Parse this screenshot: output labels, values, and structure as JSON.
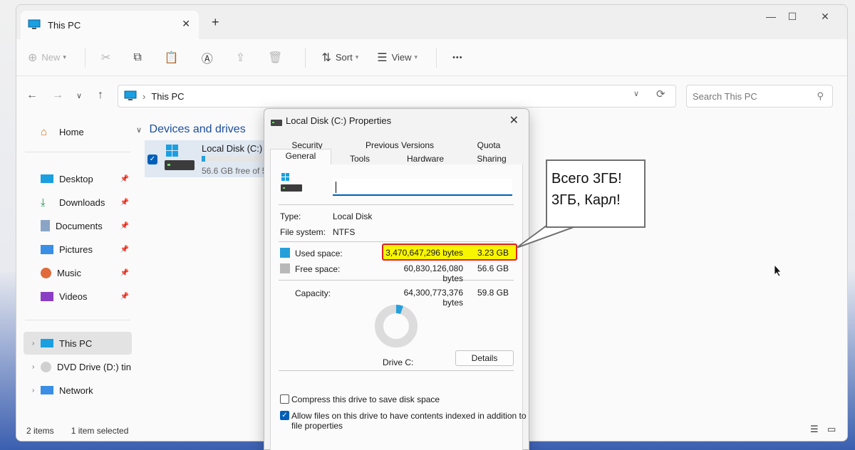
{
  "window": {
    "tab_title": "This PC",
    "new_tab_glyph": "+",
    "close_tab_glyph": "✕"
  },
  "toolbar": {
    "new_label": "New",
    "sort_label": "Sort",
    "view_label": "View",
    "more_glyph": "•••"
  },
  "address": {
    "crumb": "This PC",
    "search_placeholder": "Search This PC"
  },
  "sidebar": {
    "home": "Home",
    "pinned": [
      "Desktop",
      "Downloads",
      "Documents",
      "Pictures",
      "Music",
      "Videos"
    ],
    "this_pc": "This PC",
    "dvd": "DVD Drive (D:) tiny",
    "network": "Network"
  },
  "main": {
    "section_title": "Devices and drives",
    "drive_name": "Local Disk (C:)",
    "drive_free": "56.6 GB free of 5",
    "drive_used_fraction": 0.054
  },
  "status": {
    "items": "2 items",
    "selected": "1 item selected"
  },
  "dialog": {
    "title": "Local Disk (C:) Properties",
    "tabs_row1": [
      "Security",
      "Previous Versions",
      "Quota"
    ],
    "tabs_row2": [
      "General",
      "Tools",
      "Hardware",
      "Sharing"
    ],
    "type_label": "Type:",
    "type_value": "Local Disk",
    "fs_label": "File system:",
    "fs_value": "NTFS",
    "used_label": "Used space:",
    "used_bytes": "3,470,647,296 bytes",
    "used_gb": "3.23 GB",
    "free_label": "Free space:",
    "free_bytes": "60,830,126,080 bytes",
    "free_gb": "56.6 GB",
    "cap_label": "Capacity:",
    "cap_bytes": "64,300,773,376 bytes",
    "cap_gb": "59.8 GB",
    "drive_label": "Drive C:",
    "details_button": "Details",
    "compress_label": "Compress this drive to save disk space",
    "index_label_1": "Allow files on this drive to have contents indexed in addition to",
    "index_label_2": "file properties",
    "used_fraction": 0.054,
    "colors": {
      "used": "#26a0da",
      "free": "#b8b8b8"
    }
  },
  "callout": {
    "line1": "Всего 3ГБ!",
    "line2": "3ГБ, Карл!"
  }
}
